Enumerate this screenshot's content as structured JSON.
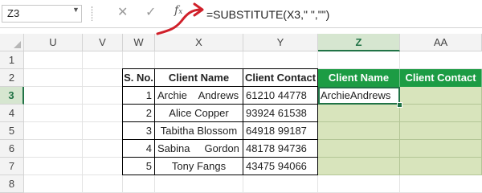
{
  "formula_bar": {
    "name_box": "Z3",
    "formula": "=SUBSTITUTE(X3,\" \",\"\")",
    "icons": [
      "cancel-icon",
      "enter-icon",
      "insert-function-icon"
    ]
  },
  "columns": [
    "U",
    "V",
    "W",
    "X",
    "Y",
    "Z",
    "AA"
  ],
  "rows": [
    "1",
    "2",
    "3",
    "4",
    "5",
    "6",
    "7",
    "8"
  ],
  "selected_column": "Z",
  "selected_row": "3",
  "table": {
    "headers": [
      "S. No.",
      "Client Name",
      "Client Contact"
    ],
    "rows": [
      {
        "sno": "1",
        "name": "Archie    Andrews",
        "contact": "61210 44778"
      },
      {
        "sno": "2",
        "name": "Alice Copper",
        "contact": "93924 61538"
      },
      {
        "sno": "3",
        "name": "Tabitha Blossom",
        "contact": "64918 99187"
      },
      {
        "sno": "4",
        "name": "Sabina     Gordon",
        "contact": "48178 94736"
      },
      {
        "sno": "5",
        "name": "Tony Fangs",
        "contact": "43475 94066"
      }
    ]
  },
  "output": {
    "headers": [
      "Client Name",
      "Client Contact"
    ],
    "z3_value": "ArchieAndrews"
  },
  "colors": {
    "header_green": "#1c9c44",
    "fill_green": "#d8e4bc",
    "selection": "#217346",
    "annotation": "#d0202a"
  }
}
